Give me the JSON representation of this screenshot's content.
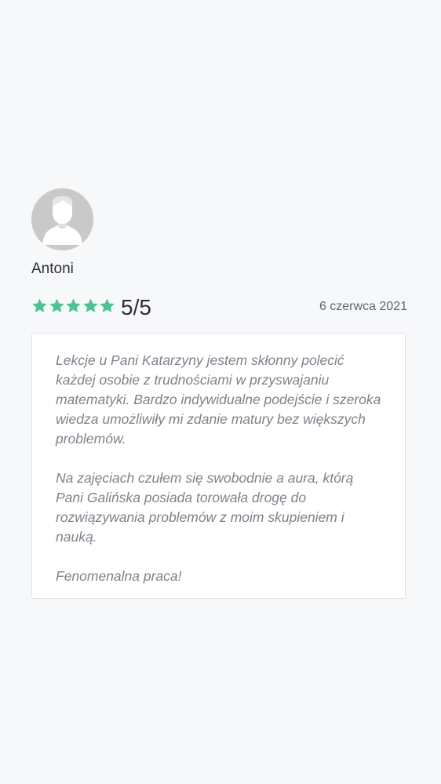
{
  "reviewer": {
    "name": "Antoni",
    "avatar_icon": "user-silhouette-icon"
  },
  "rating": {
    "score_text": "5/5",
    "stars_filled": 5,
    "stars_total": 5,
    "star_color": "#4cc391"
  },
  "review": {
    "date": "6 czerwca 2021",
    "paragraphs": [
      "Lekcje u Pani Katarzyny jestem skłonny polecić każdej osobie z trudnościami w przyswajaniu matematyki. Bardzo indywidualne podejście i szeroka wiedza umożliwiły mi zdanie matury bez większych problemów.",
      "Na zajęciach czułem się swobodnie a aura, którą Pani Galińska posiada torowała drogę do rozwiązywania problemów z moim skupieniem i nauką.",
      "Fenomenalna praca!"
    ]
  }
}
